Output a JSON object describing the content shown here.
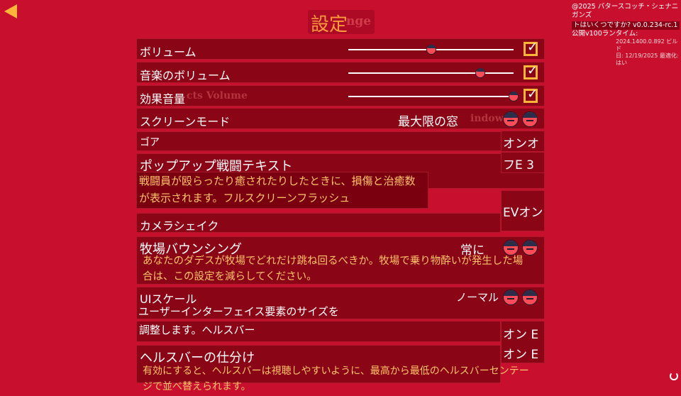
{
  "header": {
    "title": "設定",
    "ghost_title": "nge"
  },
  "credits": {
    "line1": "@2025 バタースコッチ・シェナニガンズ",
    "line2": "トはいくつですか? v0.0.234-rc.1",
    "line3": "公開v100ランタイム:",
    "line4": "2024.1400.0.892 ビルド",
    "line5": "日: 12/19/2025 最適化:",
    "line6": "はい"
  },
  "settings": {
    "volume": {
      "label": "ボリューム",
      "value": 0.5,
      "checked": true
    },
    "music_volume": {
      "label": "音楽のボリューム",
      "value": 0.8,
      "checked": true
    },
    "effects_volume": {
      "label": "効果音量",
      "ghost": "cts Volume",
      "value": 1.0,
      "checked": true
    },
    "screen_mode": {
      "label": "スクリーンモード",
      "value": "最大限の窓",
      "ghost": "indow"
    },
    "gore": {
      "label": "ゴア",
      "value": "オンオ"
    },
    "popup_text": {
      "label": "ポップアップ戦闘テキスト",
      "value": "フE 3",
      "desc_line1": "戦闘員が殴らったり癒されたりしたときに、損傷と治癒数",
      "desc_line2": "が表示されます。フルスクリーンフラッシュ"
    },
    "ev_on": {
      "value": "EVオン"
    },
    "camera_shake": {
      "label": "カメラシェイク"
    },
    "ranch_bouncing": {
      "label": "牧場バウンシング",
      "value": "常に",
      "desc_line1": "あなたのダデスが牧場でどれだけ跳ね回るべきか。牧場で乗り物酔いが発生した場",
      "desc_line2": "合は、この設定を減らしてください。"
    },
    "ui_scale": {
      "label": "UIスケール",
      "value": "ノーマル",
      "desc_line1": "ユーザーインターフェイス要素のサイズを",
      "desc_line2": "調整します。ヘルスバー"
    },
    "on_e_1": {
      "value": "オン E"
    },
    "on_e_2": {
      "value": "オン E"
    },
    "healthbar_split": {
      "label": "ヘルスバーの仕分け",
      "desc_line1": "有効にすると、ヘルスバーは視聴しやすいように、最高から最低のヘルスバーセンテー",
      "desc_line2": "ジで並べ替えられます。"
    }
  },
  "colors": {
    "background": "#c8102e",
    "panel": "#8a0515",
    "accent": "#ffb43a",
    "desc_text": "#ffc46b",
    "title_text": "#ff9a3c"
  },
  "icons": {
    "back": "back-arrow-icon",
    "check": "checkbox-icon",
    "arrow": "daddy-face-arrow-icon"
  }
}
